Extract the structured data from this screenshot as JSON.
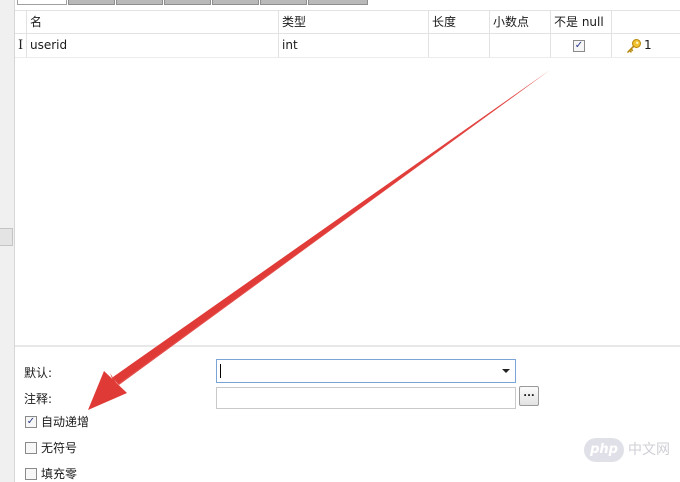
{
  "grid": {
    "headers": [
      "名",
      "类型",
      "长度",
      "小数点",
      "不是 null",
      ""
    ],
    "rows": [
      {
        "name": "userid",
        "type": "int",
        "length": "",
        "decimals": "",
        "not_null": true,
        "key_order": "1"
      }
    ]
  },
  "properties": {
    "default_label": "默认:",
    "default_value": "",
    "comment_label": "注释:",
    "comment_value": "",
    "ellipsis_label": "...",
    "auto_increment_label": "自动递增",
    "auto_increment_checked": true,
    "unsigned_label": "无符号",
    "unsigned_checked": false,
    "zerofill_label": "填充零",
    "zerofill_checked": false
  },
  "watermark": {
    "logo": "php",
    "text": "中文网"
  },
  "colors": {
    "arrow": "#e03a36",
    "focus_border": "#7ba4d6",
    "tab_fill": "#b9b9b9"
  },
  "icons": {
    "key": "key-icon",
    "checkmark": "check-icon",
    "dropdown": "chevron-down-icon"
  }
}
